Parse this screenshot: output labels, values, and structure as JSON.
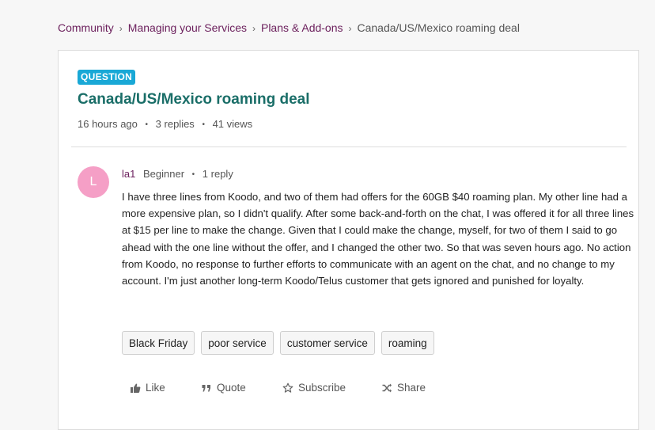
{
  "breadcrumb": {
    "items": [
      "Community",
      "Managing your Services",
      "Plans & Add-ons"
    ],
    "current": "Canada/US/Mexico roaming deal",
    "separator": "›"
  },
  "post": {
    "badge": "QUESTION",
    "title": "Canada/US/Mexico roaming deal",
    "time": "16 hours ago",
    "replies": "3 replies",
    "views": "41 views",
    "meta_separator": "•"
  },
  "author": {
    "avatar_letter": "L",
    "name": "la1",
    "rank": "Beginner",
    "replies": "1 reply"
  },
  "body": "I have three lines from Koodo, and two of them had offers for the 60GB $40 roaming plan. My other line had a more expensive plan, so I didn't qualify. After some back-and-forth on the chat, I was offered it for all three lines at $15 per line to make the change. Given that I could make the change, myself, for two of them I said to go ahead with the one line without the offer, and I changed the other two. So that was seven hours ago. No action from Koodo, no response to further efforts to communicate with an agent on the chat, and no change to my account. I'm just another long-term Koodo/Telus customer that gets ignored and punished for loyalty.",
  "tags": [
    "Black Friday",
    "poor service",
    "customer service",
    "roaming"
  ],
  "actions": {
    "like": "Like",
    "quote": "Quote",
    "subscribe": "Subscribe",
    "share": "Share"
  },
  "colors": {
    "badge": "#19a8d6",
    "title": "#1a6e68",
    "link": "#6b1f5c",
    "avatar": "#f59fc6"
  }
}
